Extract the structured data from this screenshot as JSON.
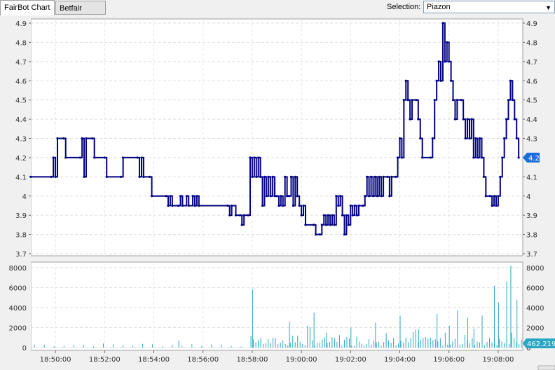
{
  "tabs": [
    {
      "label": "FairBot Chart",
      "active": true
    },
    {
      "label": "Betfair Chart",
      "active": false
    }
  ],
  "selection": {
    "label": "Selection:",
    "value": "Piazon"
  },
  "colors": {
    "price_line": "#000080",
    "volume_bars": "#2aa6c4",
    "current_badge": "#1a6fd6",
    "volume_badge": "#2aa6c4"
  },
  "chart_data": {
    "type": "line",
    "x_axis": {
      "ticks": [
        "18:50:00",
        "18:52:00",
        "18:54:00",
        "18:56:00",
        "18:58:00",
        "19:00:00",
        "19:02:00",
        "19:04:00",
        "19:06:00",
        "19:08:00"
      ],
      "range": [
        "18:49:00",
        "19:09:00"
      ]
    },
    "price": {
      "y_ticks": [
        "4.9",
        "4.8",
        "4.7",
        "4.6",
        "4.5",
        "4.4",
        "4.3",
        "4.2",
        "4.1",
        "4",
        "3.9",
        "3.8",
        "3.7"
      ],
      "ylim": [
        3.7,
        4.9
      ],
      "current_value": "4.2",
      "points": [
        [
          "18:49:00",
          4.1
        ],
        [
          "18:49:50",
          4.1
        ],
        [
          "18:49:55",
          4.2
        ],
        [
          "18:50:00",
          4.1
        ],
        [
          "18:50:05",
          4.3
        ],
        [
          "18:50:20",
          4.3
        ],
        [
          "18:50:25",
          4.2
        ],
        [
          "18:51:00",
          4.2
        ],
        [
          "18:51:05",
          4.3
        ],
        [
          "18:51:10",
          4.1
        ],
        [
          "18:51:15",
          4.3
        ],
        [
          "18:51:30",
          4.3
        ],
        [
          "18:51:35",
          4.2
        ],
        [
          "18:52:00",
          4.2
        ],
        [
          "18:52:05",
          4.1
        ],
        [
          "18:52:40",
          4.1
        ],
        [
          "18:52:45",
          4.2
        ],
        [
          "18:53:20",
          4.2
        ],
        [
          "18:53:25",
          4.1
        ],
        [
          "18:53:30",
          4.2
        ],
        [
          "18:53:35",
          4.1
        ],
        [
          "18:53:50",
          4.1
        ],
        [
          "18:53:55",
          4.0
        ],
        [
          "18:54:30",
          4.0
        ],
        [
          "18:54:35",
          3.95
        ],
        [
          "18:54:40",
          4.0
        ],
        [
          "18:54:45",
          3.95
        ],
        [
          "18:55:00",
          3.95
        ],
        [
          "18:55:05",
          4.0
        ],
        [
          "18:55:10",
          3.95
        ],
        [
          "18:55:20",
          4.0
        ],
        [
          "18:55:25",
          3.95
        ],
        [
          "18:55:35",
          4.0
        ],
        [
          "18:55:40",
          3.95
        ],
        [
          "18:55:45",
          4.0
        ],
        [
          "18:55:50",
          3.95
        ],
        [
          "18:57:00",
          3.95
        ],
        [
          "18:57:05",
          3.9
        ],
        [
          "18:57:10",
          3.95
        ],
        [
          "18:57:20",
          3.9
        ],
        [
          "18:57:30",
          3.9
        ],
        [
          "18:57:35",
          3.85
        ],
        [
          "18:57:40",
          3.9
        ],
        [
          "18:57:50",
          3.9
        ],
        [
          "18:57:55",
          4.2
        ],
        [
          "18:58:00",
          4.1
        ],
        [
          "18:58:05",
          4.2
        ],
        [
          "18:58:10",
          4.1
        ],
        [
          "18:58:15",
          4.2
        ],
        [
          "18:58:20",
          4.1
        ],
        [
          "18:58:25",
          3.95
        ],
        [
          "18:58:30",
          4.1
        ],
        [
          "18:58:35",
          4.0
        ],
        [
          "18:58:40",
          4.1
        ],
        [
          "18:58:45",
          4.0
        ],
        [
          "18:58:50",
          4.1
        ],
        [
          "18:58:55",
          4.0
        ],
        [
          "18:59:00",
          4.0
        ],
        [
          "18:59:05",
          3.95
        ],
        [
          "18:59:10",
          4.0
        ],
        [
          "18:59:15",
          3.95
        ],
        [
          "18:59:20",
          4.1
        ],
        [
          "18:59:25",
          4.0
        ],
        [
          "18:59:30",
          4.0
        ],
        [
          "18:59:35",
          4.1
        ],
        [
          "18:59:40",
          3.95
        ],
        [
          "18:59:45",
          4.1
        ],
        [
          "18:59:50",
          4.0
        ],
        [
          "18:59:55",
          3.95
        ],
        [
          "19:00:00",
          3.9
        ],
        [
          "19:00:05",
          3.95
        ],
        [
          "19:00:10",
          3.85
        ],
        [
          "19:00:30",
          3.85
        ],
        [
          "19:00:35",
          3.8
        ],
        [
          "19:00:45",
          3.8
        ],
        [
          "19:00:50",
          3.85
        ],
        [
          "19:00:55",
          3.9
        ],
        [
          "19:01:00",
          3.85
        ],
        [
          "19:01:05",
          3.9
        ],
        [
          "19:01:10",
          3.85
        ],
        [
          "19:01:15",
          3.9
        ],
        [
          "19:01:20",
          3.85
        ],
        [
          "19:01:25",
          4.0
        ],
        [
          "19:01:30",
          3.95
        ],
        [
          "19:01:35",
          4.0
        ],
        [
          "19:01:40",
          3.9
        ],
        [
          "19:01:45",
          3.8
        ],
        [
          "19:01:50",
          3.9
        ],
        [
          "19:01:55",
          3.85
        ],
        [
          "19:02:00",
          3.95
        ],
        [
          "19:02:05",
          3.9
        ],
        [
          "19:02:10",
          3.95
        ],
        [
          "19:02:15",
          3.9
        ],
        [
          "19:02:20",
          3.95
        ],
        [
          "19:02:30",
          3.95
        ],
        [
          "19:02:35",
          4.0
        ],
        [
          "19:02:40",
          4.1
        ],
        [
          "19:02:45",
          4.0
        ],
        [
          "19:02:50",
          4.1
        ],
        [
          "19:02:55",
          4.0
        ],
        [
          "19:03:00",
          4.1
        ],
        [
          "19:03:05",
          4.0
        ],
        [
          "19:03:10",
          4.1
        ],
        [
          "19:03:15",
          4.0
        ],
        [
          "19:03:20",
          4.1
        ],
        [
          "19:03:30",
          4.1
        ],
        [
          "19:03:35",
          4.0
        ],
        [
          "19:03:40",
          4.1
        ],
        [
          "19:03:50",
          4.1
        ],
        [
          "19:03:55",
          4.2
        ],
        [
          "19:04:00",
          4.3
        ],
        [
          "19:04:05",
          4.2
        ],
        [
          "19:04:10",
          4.5
        ],
        [
          "19:04:15",
          4.6
        ],
        [
          "19:04:20",
          4.5
        ],
        [
          "19:04:25",
          4.4
        ],
        [
          "19:04:30",
          4.5
        ],
        [
          "19:04:40",
          4.5
        ],
        [
          "19:04:45",
          4.4
        ],
        [
          "19:04:50",
          4.3
        ],
        [
          "19:04:55",
          4.2
        ],
        [
          "19:05:15",
          4.2
        ],
        [
          "19:05:20",
          4.3
        ],
        [
          "19:05:25",
          4.5
        ],
        [
          "19:05:30",
          4.6
        ],
        [
          "19:05:35",
          4.7
        ],
        [
          "19:05:40",
          4.6
        ],
        [
          "19:05:45",
          4.9
        ],
        [
          "19:05:50",
          4.7
        ],
        [
          "19:05:55",
          4.8
        ],
        [
          "19:06:00",
          4.7
        ],
        [
          "19:06:05",
          4.6
        ],
        [
          "19:06:10",
          4.5
        ],
        [
          "19:06:15",
          4.4
        ],
        [
          "19:06:20",
          4.5
        ],
        [
          "19:06:30",
          4.5
        ],
        [
          "19:06:35",
          4.4
        ],
        [
          "19:06:40",
          4.3
        ],
        [
          "19:06:45",
          4.4
        ],
        [
          "19:06:50",
          4.3
        ],
        [
          "19:06:55",
          4.4
        ],
        [
          "19:07:00",
          4.2
        ],
        [
          "19:07:05",
          4.3
        ],
        [
          "19:07:10",
          4.2
        ],
        [
          "19:07:15",
          4.3
        ],
        [
          "19:07:20",
          4.2
        ],
        [
          "19:07:25",
          4.1
        ],
        [
          "19:07:30",
          4.0
        ],
        [
          "19:07:40",
          4.0
        ],
        [
          "19:07:45",
          3.95
        ],
        [
          "19:07:50",
          4.0
        ],
        [
          "19:07:55",
          3.95
        ],
        [
          "19:08:00",
          4.0
        ],
        [
          "19:08:05",
          4.1
        ],
        [
          "19:08:10",
          4.2
        ],
        [
          "19:08:15",
          4.3
        ],
        [
          "19:08:20",
          4.4
        ],
        [
          "19:08:25",
          4.5
        ],
        [
          "19:08:30",
          4.6
        ],
        [
          "19:08:35",
          4.5
        ],
        [
          "19:08:40",
          4.4
        ],
        [
          "19:08:45",
          4.3
        ],
        [
          "19:08:50",
          4.2
        ]
      ]
    },
    "volume": {
      "y_ticks": [
        "8000",
        "6000",
        "4000",
        "2000",
        "0"
      ],
      "ylim": [
        0,
        8000
      ],
      "current_value": "462.219",
      "spikes": [
        [
          "18:55:00",
          700
        ],
        [
          "18:58:00",
          5800
        ],
        [
          "18:59:30",
          2600
        ],
        [
          "19:00:30",
          3500
        ],
        [
          "19:01:00",
          1500
        ],
        [
          "19:02:00",
          2000
        ],
        [
          "19:03:00",
          2500
        ],
        [
          "19:04:00",
          3200
        ],
        [
          "19:04:45",
          1800
        ],
        [
          "19:05:30",
          3400
        ],
        [
          "19:06:00",
          2200
        ],
        [
          "19:06:20",
          3700
        ],
        [
          "19:06:45",
          3000
        ],
        [
          "19:07:00",
          1900
        ],
        [
          "19:07:20",
          3200
        ],
        [
          "19:07:50",
          6200
        ],
        [
          "19:08:00",
          4500
        ],
        [
          "19:08:20",
          6600
        ],
        [
          "19:08:30",
          8200
        ],
        [
          "19:08:45",
          4800
        ]
      ]
    }
  }
}
